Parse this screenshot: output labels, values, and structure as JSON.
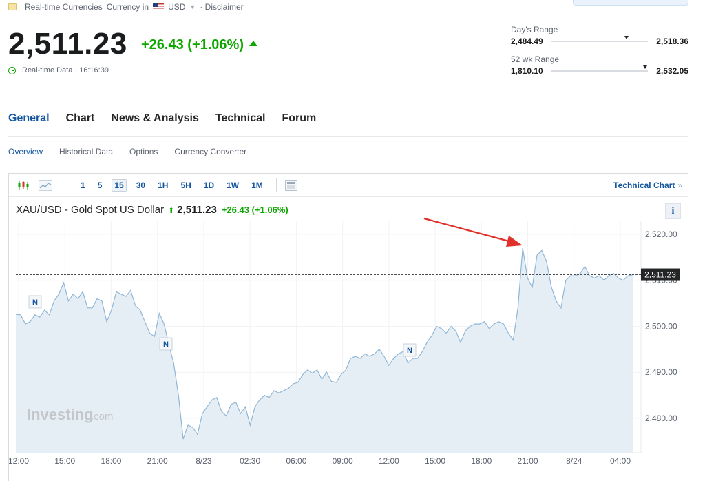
{
  "topbar": {
    "realtime_label": "Real-time Currencies",
    "currency_in": "Currency in",
    "currency": "USD",
    "disclaimer": "· Disclaimer"
  },
  "quote": {
    "price": "2,511.23",
    "change": "+26.43 (+1.06%)",
    "realtime": "Real-time Data · 16:16:39"
  },
  "days_range": {
    "label": "Day's Range",
    "low": "2,484.49",
    "high": "2,518.36",
    "position": 0.78
  },
  "wk52_range": {
    "label": "52 wk Range",
    "low": "1,810.10",
    "high": "2,532.05",
    "position": 0.97
  },
  "tabs": [
    "General",
    "Chart",
    "News & Analysis",
    "Technical",
    "Forum"
  ],
  "active_tab": "General",
  "subtabs": [
    "Overview",
    "Historical Data",
    "Options",
    "Currency Converter"
  ],
  "toolbar": {
    "timeframes": [
      "1",
      "5",
      "15",
      "30",
      "1H",
      "5H",
      "1D",
      "1W",
      "1M"
    ],
    "active_timeframe": "15",
    "technical_link": "Technical Chart",
    "arrow": "»"
  },
  "chart_header": {
    "title": "XAU/USD - Gold Spot US Dollar",
    "price": "2,511.23",
    "change": "+26.43 (+1.06%)",
    "info": "i"
  },
  "watermark": {
    "brand": "Investing",
    "suffix": ".com"
  },
  "colors": {
    "accent": "#1256a0",
    "up": "#0ea600",
    "line": "#8fb6d6",
    "fill": "#e6eef5",
    "arrow": "#e0302a"
  },
  "chart_data": {
    "type": "area",
    "title": "XAU/USD - Gold Spot US Dollar",
    "x_ticks": [
      "12:00",
      "15:00",
      "18:00",
      "21:00",
      "8/23",
      "02:30",
      "06:00",
      "09:00",
      "12:00",
      "15:00",
      "18:00",
      "21:00",
      "8/24",
      "04:00"
    ],
    "y_ticks": [
      "2,480.00",
      "2,490.00",
      "2,500.00",
      "2,510.00",
      "2,520.00"
    ],
    "ylim": [
      2472.5,
      2521.5
    ],
    "last_value": 2511.23,
    "last_label": "2,511.23",
    "news_marker_label": "N",
    "news_markers": [
      1,
      3,
      11
    ],
    "annotation": "red arrow pointing to session high",
    "values": [
      2502.6,
      2502.5,
      2500.5,
      2501.0,
      2502.5,
      2502.0,
      2503.5,
      2502.5,
      2505.5,
      2507.0,
      2509.5,
      2505.5,
      2507.0,
      2506.0,
      2507.5,
      2504.0,
      2504.0,
      2506.0,
      2505.5,
      2501.0,
      2503.5,
      2507.5,
      2507.0,
      2506.5,
      2507.8,
      2504.5,
      2503.5,
      2501.0,
      2498.5,
      2497.8,
      2502.8,
      2500.5,
      2496.0,
      2492.0,
      2485.0,
      2475.5,
      2478.5,
      2478.0,
      2476.5,
      2481.0,
      2482.5,
      2484.0,
      2484.5,
      2481.5,
      2480.5,
      2483.0,
      2483.5,
      2481.0,
      2482.5,
      2478.5,
      2482.5,
      2484.0,
      2485.0,
      2484.5,
      2486.0,
      2485.5,
      2486.0,
      2486.5,
      2487.5,
      2487.8,
      2489.5,
      2490.5,
      2489.8,
      2490.5,
      2488.5,
      2490.0,
      2488.0,
      2487.8,
      2489.5,
      2490.5,
      2493.0,
      2493.5,
      2493.0,
      2494.0,
      2493.5,
      2494.0,
      2495.0,
      2493.5,
      2491.5,
      2493.0,
      2494.0,
      2494.5,
      2492.0,
      2493.0,
      2493.0,
      2494.5,
      2496.5,
      2498.0,
      2500.0,
      2499.5,
      2498.5,
      2500.0,
      2499.0,
      2496.5,
      2499.0,
      2500.0,
      2500.5,
      2500.5,
      2501.0,
      2499.5,
      2500.5,
      2501.0,
      2500.5,
      2498.5,
      2497.0,
      2504.0,
      2517.0,
      2510.5,
      2508.5,
      2515.5,
      2516.5,
      2514.0,
      2508.5,
      2505.5,
      2504.0,
      2510.0,
      2511.0,
      2511.0,
      2511.5,
      2513.0,
      2511.0,
      2510.5,
      2511.0,
      2510.0,
      2511.0,
      2511.5,
      2510.5,
      2510.0,
      2511.0,
      2511.2
    ]
  }
}
